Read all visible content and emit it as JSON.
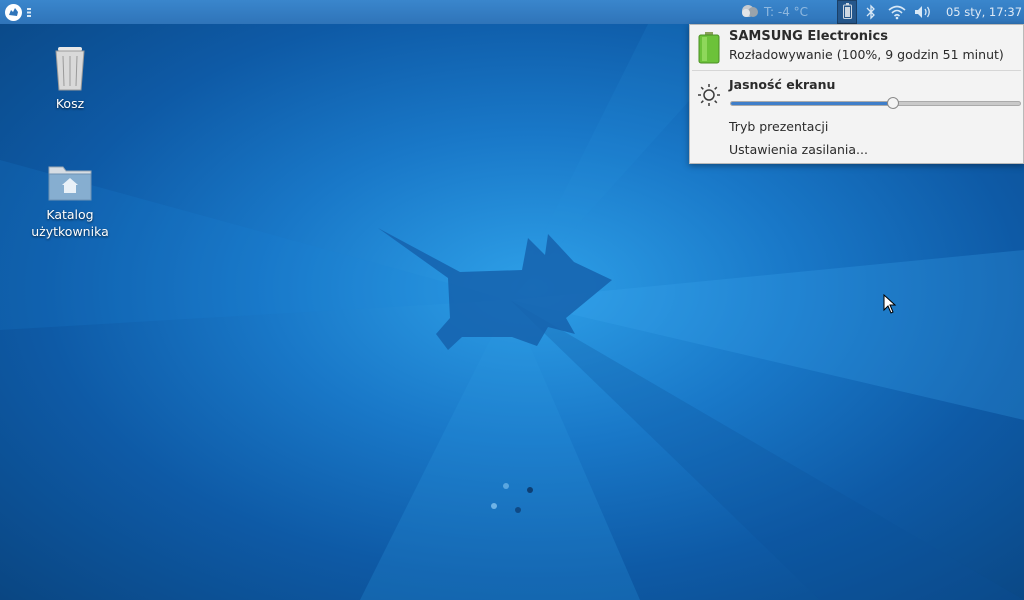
{
  "panel": {
    "weather_temp": "T: -4 °C",
    "clock": "05 sty, 17:37"
  },
  "desktop": {
    "icons": [
      {
        "label": "Kosz"
      },
      {
        "label_line1": "Katalog",
        "label_line2": "użytkownika"
      }
    ]
  },
  "power_popup": {
    "device_name": "SAMSUNG Electronics",
    "status": "Rozładowywanie (100%, 9 godzin 51 minut)",
    "brightness_label": "Jasność ekranu",
    "brightness_level": 0.56,
    "presentation_mode": "Tryb prezentacji",
    "power_settings": "Ustawienia zasilania..."
  },
  "colors": {
    "panel": "#2f74b9",
    "battery_green": "#6cc23a",
    "slider_fill": "#3f7ec9"
  }
}
